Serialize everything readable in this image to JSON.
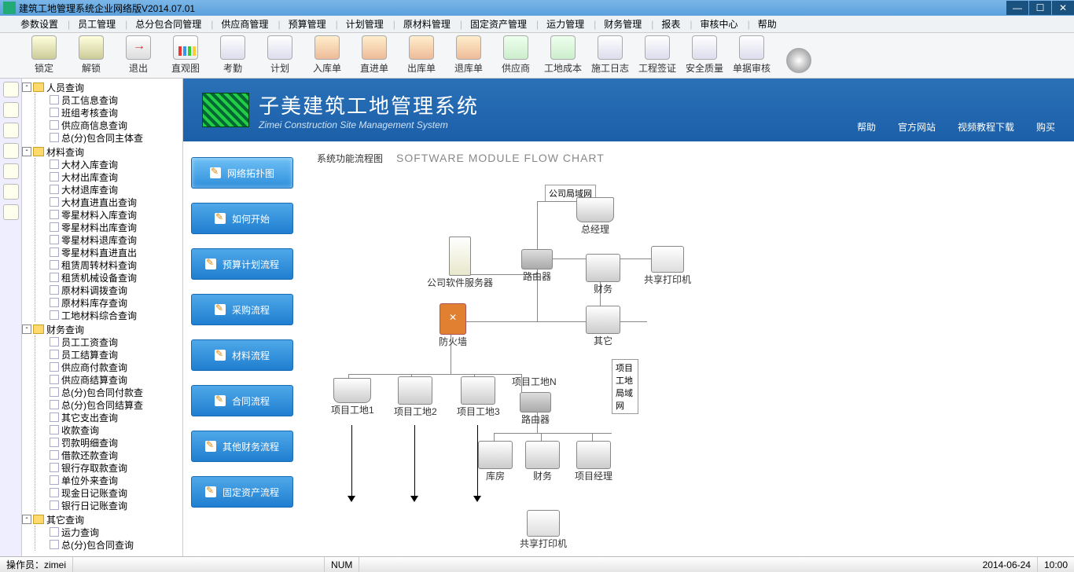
{
  "window": {
    "title": "建筑工地管理系统企业网络版V2014.07.01"
  },
  "winbtns": {
    "min": "—",
    "max": "☐",
    "close": "✕"
  },
  "menu": [
    "参数设置",
    "员工管理",
    "总分包合同管理",
    "供应商管理",
    "预算管理",
    "计划管理",
    "原材料管理",
    "固定资产管理",
    "运力管理",
    "财务管理",
    "报表",
    "审核中心",
    "帮助"
  ],
  "toolbar": [
    {
      "label": "锁定",
      "icon": "lock"
    },
    {
      "label": "解锁",
      "icon": "lock"
    },
    {
      "label": "退出",
      "icon": "exit"
    },
    {
      "label": "直观图",
      "icon": "chart"
    },
    {
      "label": "考勤",
      "icon": "doc"
    },
    {
      "label": "计划",
      "icon": "doc"
    },
    {
      "label": "入库单",
      "icon": "house"
    },
    {
      "label": "直进单",
      "icon": "house"
    },
    {
      "label": "出库单",
      "icon": "house"
    },
    {
      "label": "退库单",
      "icon": "house"
    },
    {
      "label": "供应商",
      "icon": "money"
    },
    {
      "label": "工地成本",
      "icon": "money"
    },
    {
      "label": "施工日志",
      "icon": "doc"
    },
    {
      "label": "工程签证",
      "icon": "doc"
    },
    {
      "label": "安全质量",
      "icon": "doc"
    },
    {
      "label": "单据审核",
      "icon": "doc"
    },
    {
      "label": "",
      "icon": "speaker"
    }
  ],
  "tree": [
    {
      "label": "人员查询",
      "children": [
        "员工信息查询",
        "班组考核查询",
        "供应商信息查询",
        "总(分)包合同主体查"
      ]
    },
    {
      "label": "材料查询",
      "children": [
        "大材入库查询",
        "大材出库查询",
        "大材退库查询",
        "大材直进直出查询",
        "零星材料入库查询",
        "零星材料出库查询",
        "零星材料退库查询",
        "零星材料直进直出",
        "租赁周转材料查询",
        "租赁机械设备查询",
        "原材料调拨查询",
        "原材料库存查询",
        "工地材料综合查询"
      ]
    },
    {
      "label": "财务查询",
      "children": [
        "员工工资查询",
        "员工结算查询",
        "供应商付款查询",
        "供应商结算查询",
        "总(分)包合同付款查",
        "总(分)包合同结算查",
        "其它支出查询",
        "收款查询",
        "罚款明细查询",
        "借款还款查询",
        "银行存取款查询",
        "单位外来查询",
        "现金日记账查询",
        "银行日记账查询"
      ]
    },
    {
      "label": "其它查询",
      "children": [
        "运力查询",
        "总(分)包合同查询"
      ]
    }
  ],
  "banner": {
    "title_cn": "子美建筑工地管理系统",
    "title_en": "Zimei Construction Site Management System",
    "links": [
      "帮助",
      "官方网站",
      "视频教程下载",
      "购买"
    ]
  },
  "sidebtns": [
    "网络拓扑图",
    "如何开始",
    "预算计划流程",
    "采购流程",
    "材料流程",
    "合同流程",
    "其他财务流程",
    "固定资产流程"
  ],
  "diagram": {
    "title_cn": "系统功能流程图",
    "title_en": "SOFTWARE MODULE FLOW CHART",
    "nodes": {
      "server": "公司软件服务器",
      "firewall": "防火墙",
      "router1": "路由器",
      "gm": "总经理",
      "finance1": "财务",
      "other": "其它",
      "printer1": "共享打印机",
      "box1": "公司局域网",
      "site1": "项目工地1",
      "site2": "项目工地2",
      "site3": "项目工地3",
      "siten": "项目工地N",
      "router2": "路由器",
      "box2": "项目工地局域网",
      "warehouse": "库房",
      "finance2": "财务",
      "pm": "项目经理",
      "printer2": "共享打印机"
    }
  },
  "status": {
    "operator_label": "操作员：",
    "operator": "zimei",
    "num": "NUM",
    "date": "2014-06-24",
    "time": "10:00"
  }
}
